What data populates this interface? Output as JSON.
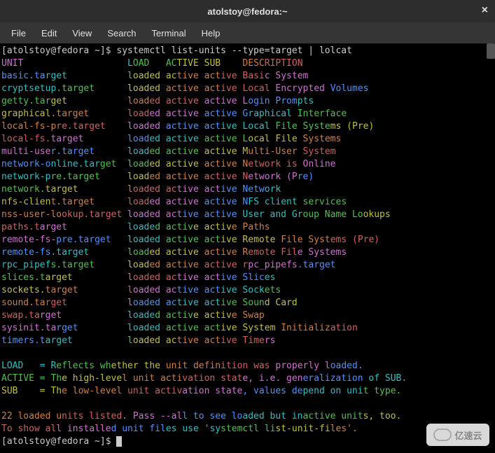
{
  "window": {
    "title": "atolstoy@fedora:~",
    "close": "×"
  },
  "menu": [
    "File",
    "Edit",
    "View",
    "Search",
    "Terminal",
    "Help"
  ],
  "prompt1": "[atolstoy@fedora ~]$ ",
  "command": "systemctl list-units --type=target | lolcat",
  "header": {
    "unit": "UNIT",
    "load": "LOAD",
    "active": "ACTIVE",
    "sub": "SUB",
    "desc": "DESCRIPTION"
  },
  "rows": [
    {
      "unit": "basic.target",
      "load": "loaded",
      "active": "active",
      "sub": "active",
      "desc": "Basic System"
    },
    {
      "unit": "cryptsetup.target",
      "load": "loaded",
      "active": "active",
      "sub": "active",
      "desc": "Local Encrypted Volumes"
    },
    {
      "unit": "getty.target",
      "load": "loaded",
      "active": "active",
      "sub": "active",
      "desc": "Login Prompts"
    },
    {
      "unit": "graphical.target",
      "load": "loaded",
      "active": "active",
      "sub": "active",
      "desc": "Graphical Interface"
    },
    {
      "unit": "local-fs-pre.target",
      "load": "loaded",
      "active": "active",
      "sub": "active",
      "desc": "Local File Systems (Pre)"
    },
    {
      "unit": "local-fs.target",
      "load": "loaded",
      "active": "active",
      "sub": "active",
      "desc": "Local File Systems"
    },
    {
      "unit": "multi-user.target",
      "load": "loaded",
      "active": "active",
      "sub": "active",
      "desc": "Multi-User System"
    },
    {
      "unit": "network-online.target",
      "load": "loaded",
      "active": "active",
      "sub": "active",
      "desc": "Network is Online"
    },
    {
      "unit": "network-pre.target",
      "load": "loaded",
      "active": "active",
      "sub": "active",
      "desc": "Network (Pre)"
    },
    {
      "unit": "network.target",
      "load": "loaded",
      "active": "active",
      "sub": "active",
      "desc": "Network"
    },
    {
      "unit": "nfs-client.target",
      "load": "loaded",
      "active": "active",
      "sub": "active",
      "desc": "NFS client services"
    },
    {
      "unit": "nss-user-lookup.target",
      "load": "loaded",
      "active": "active",
      "sub": "active",
      "desc": "User and Group Name Lookups"
    },
    {
      "unit": "paths.target",
      "load": "loaded",
      "active": "active",
      "sub": "active",
      "desc": "Paths"
    },
    {
      "unit": "remote-fs-pre.target",
      "load": "loaded",
      "active": "active",
      "sub": "active",
      "desc": "Remote File Systems (Pre)"
    },
    {
      "unit": "remote-fs.target",
      "load": "loaded",
      "active": "active",
      "sub": "active",
      "desc": "Remote File Systems"
    },
    {
      "unit": "rpc_pipefs.target",
      "load": "loaded",
      "active": "active",
      "sub": "active",
      "desc": "rpc_pipefs.target"
    },
    {
      "unit": "slices.target",
      "load": "loaded",
      "active": "active",
      "sub": "active",
      "desc": "Slices"
    },
    {
      "unit": "sockets.target",
      "load": "loaded",
      "active": "active",
      "sub": "active",
      "desc": "Sockets"
    },
    {
      "unit": "sound.target",
      "load": "loaded",
      "active": "active",
      "sub": "active",
      "desc": "Sound Card"
    },
    {
      "unit": "swap.target",
      "load": "loaded",
      "active": "active",
      "sub": "active",
      "desc": "Swap"
    },
    {
      "unit": "sysinit.target",
      "load": "loaded",
      "active": "active",
      "sub": "active",
      "desc": "System Initialization"
    },
    {
      "unit": "timers.target",
      "load": "loaded",
      "active": "active",
      "sub": "active",
      "desc": "Timers"
    }
  ],
  "legend": {
    "load": "LOAD   = Reflects whether the unit definition was properly loaded.",
    "active": "ACTIVE = The high-level unit activation state, i.e. generalization of SUB.",
    "sub": "SUB    = The low-level unit activation state, values depend on unit type."
  },
  "footer1": "22 loaded units listed. Pass --all to see loaded but inactive units, too.",
  "footer2": "To show all installed unit files use 'systemctl list-unit-files'.",
  "prompt2": "[atolstoy@fedora ~]$ ",
  "watermark": "亿速云"
}
